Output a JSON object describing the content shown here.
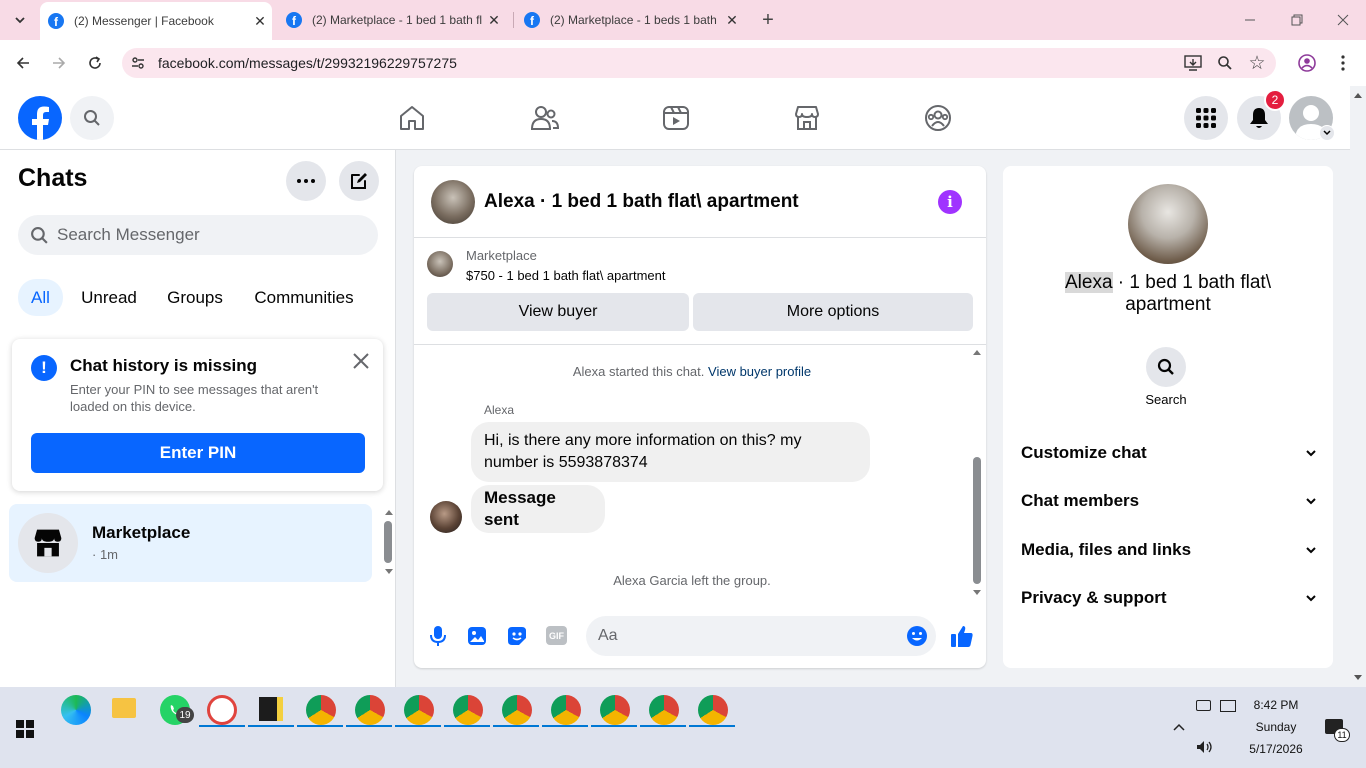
{
  "browser": {
    "tabs": [
      {
        "title": "(2) Messenger | Facebook",
        "active": true
      },
      {
        "title": "(2) Marketplace - 1 bed 1 bath fl",
        "active": false
      },
      {
        "title": "(2) Marketplace - 1 beds 1 bath",
        "active": false
      }
    ],
    "url": "facebook.com/messages/t/29932196229757275"
  },
  "header": {
    "notification_count": "2"
  },
  "chats": {
    "title": "Chats",
    "search_placeholder": "Search Messenger",
    "filters": [
      "All",
      "Unread",
      "Groups",
      "Communities"
    ],
    "notice": {
      "title": "Chat history is missing",
      "body": "Enter your PIN to see messages that aren't loaded on this device.",
      "button": "Enter PIN"
    },
    "items": [
      {
        "name": "Marketplace",
        "meta": "· 1m"
      }
    ]
  },
  "conversation": {
    "title": "Alexa · 1 bed 1 bath flat\\ apartment",
    "listing_source": "Marketplace",
    "listing_price": "$750 - 1 bed 1 bath flat\\ apartment",
    "view_buyer": "View buyer",
    "more_options": "More options",
    "started_text": "Alexa started this chat.",
    "view_buyer_profile": "View buyer profile",
    "sender_name": "Alexa",
    "message_1": "Hi, is there any more information on this? my number is 5593878374",
    "message_2": "Message sent",
    "left_text": "Alexa Garcia left the group.",
    "composer_placeholder": "Aa"
  },
  "details": {
    "name_highlight": "Alexa",
    "name_rest": " · 1 bed 1 bath flat\\",
    "name_line2": "apartment",
    "search_label": "Search",
    "sections": [
      "Customize chat",
      "Chat members",
      "Media, files and links",
      "Privacy & support"
    ]
  },
  "taskbar": {
    "whatsapp_badge": "19",
    "time": "8:42 PM",
    "day": "Sunday",
    "date": "5/17/2026",
    "notif_count": "11"
  },
  "colors": {
    "fb_blue": "#0866ff",
    "messenger_purple": "#a033ff",
    "notification_red": "#e41e3f",
    "tab_strip": "#f8dbe6"
  }
}
